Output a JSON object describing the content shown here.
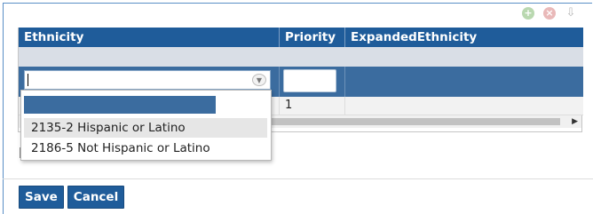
{
  "header_icons": {
    "add": "+",
    "delete": "×",
    "refresh": "⇩"
  },
  "grid": {
    "columns": [
      "Ethnicity",
      "Priority",
      "ExpandedEthnicity"
    ],
    "rows": [
      {
        "ethnicity": "",
        "priority": "1",
        "expanded": ""
      }
    ]
  },
  "dropdown": {
    "options": [
      "",
      "2135-2 Hispanic or Latino",
      "2186-5 Not Hispanic or Latino"
    ]
  },
  "footer": {
    "save_label": "Save",
    "cancel_label": "Cancel"
  },
  "colors": {
    "header": "#1f5c9a",
    "edit_row": "#3b6c9f",
    "filter_row": "#d9dee6"
  }
}
